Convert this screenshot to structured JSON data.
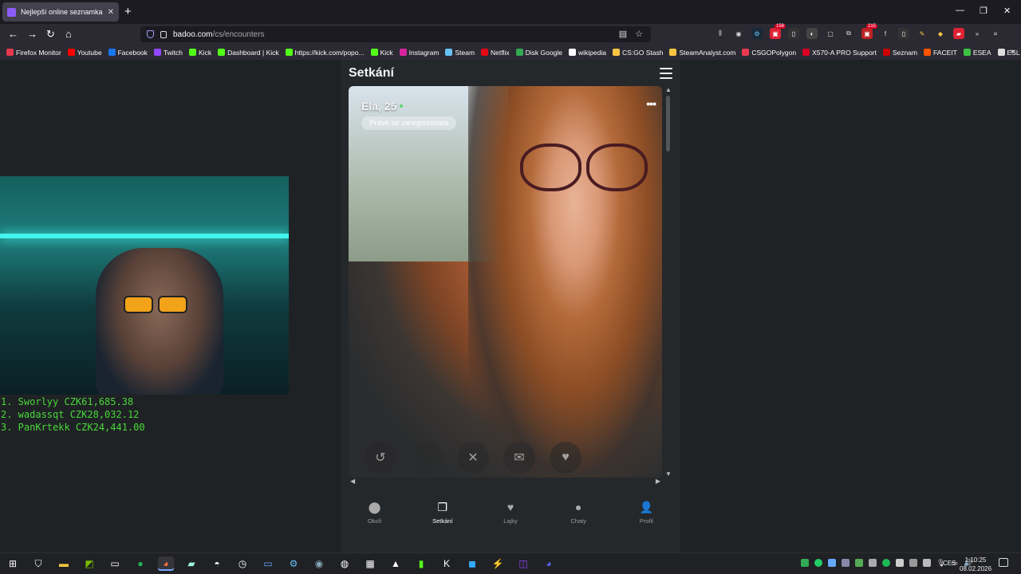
{
  "browser": {
    "tab": {
      "title": "Nejlepší online seznamka zdarma"
    },
    "url": {
      "domain": "badoo.com",
      "path": "/cs/encounters"
    },
    "extension_badges": {
      "ext1": "158",
      "ext2": "215"
    }
  },
  "bookmarks": [
    {
      "label": "Firefox Monitor",
      "color": "#e63950"
    },
    {
      "label": "Youtube",
      "color": "#ff0000"
    },
    {
      "label": "Facebook",
      "color": "#1877f2"
    },
    {
      "label": "Twitch",
      "color": "#9146ff"
    },
    {
      "label": "Kick",
      "color": "#53fc18"
    },
    {
      "label": "Dashboard | Kick",
      "color": "#53fc18"
    },
    {
      "label": "https://kick.com/popo...",
      "color": "#53fc18"
    },
    {
      "label": "Kick",
      "color": "#53fc18"
    },
    {
      "label": "Instagram",
      "color": "#d6249f"
    },
    {
      "label": "Steam",
      "color": "#66c0f4"
    },
    {
      "label": "Netflix",
      "color": "#e50914"
    },
    {
      "label": "Disk Google",
      "color": "#34a853"
    },
    {
      "label": "wikipedia",
      "color": "#ffffff"
    },
    {
      "label": "CS:GO Stash",
      "color": "#f5c542"
    },
    {
      "label": "SteamAnalyst.com",
      "color": "#f5c542"
    },
    {
      "label": "CSGOPolygon",
      "color": "#e63950"
    },
    {
      "label": "X570-A PRO Support",
      "color": "#d70022"
    },
    {
      "label": "Seznam",
      "color": "#cc0000"
    },
    {
      "label": "FACEIT",
      "color": "#ff5500"
    },
    {
      "label": "ESEA",
      "color": "#3ec143"
    },
    {
      "label": "ESL",
      "color": "#dddddd"
    }
  ],
  "overlay": {
    "leaderboard": [
      "1. Sworlyy CZK61,685.38",
      "2. wadassqt CZK28,032.12",
      "3. PanKrtekk CZK24,441.00"
    ]
  },
  "badoo": {
    "title": "Setkání",
    "profile": {
      "name": "Ela, 25",
      "status_pill": "Právě se zaregistrovala"
    },
    "nav": [
      {
        "label": "Okolí",
        "icon": "location-pin-icon",
        "active": false
      },
      {
        "label": "Setkání",
        "icon": "cards-icon",
        "active": true
      },
      {
        "label": "Lajky",
        "icon": "hearts-icon",
        "active": false
      },
      {
        "label": "Chaty",
        "icon": "chat-bubble-icon",
        "active": false
      },
      {
        "label": "Profil",
        "icon": "person-icon",
        "active": false
      }
    ]
  },
  "taskbar": {
    "language": "CES",
    "time": "1:10:25",
    "date": "08.02.2026"
  },
  "colors": {
    "page_bg": "#1f2224",
    "panel_bg": "#25282b",
    "leaderboard_green": "#48d83a",
    "online_dot": "#5fd36a"
  }
}
